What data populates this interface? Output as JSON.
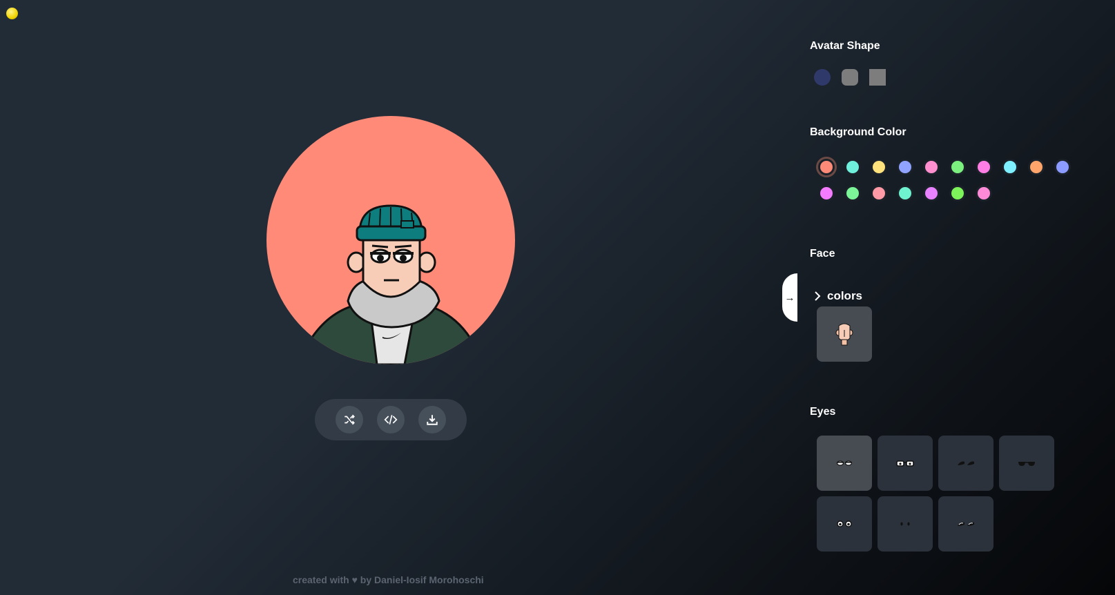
{
  "sections": {
    "avatar_shape": "Avatar Shape",
    "background_color": "Background Color",
    "face": "Face",
    "eyes": "Eyes"
  },
  "face_colors_label": "colors",
  "avatar_shapes": [
    {
      "name": "circle",
      "color": "#2f3a6b"
    },
    {
      "name": "rounded",
      "color": "#7d7d7d"
    },
    {
      "name": "square",
      "color": "#7d7d7d"
    }
  ],
  "background_colors": [
    "#ff8a78",
    "#6ff0dc",
    "#ffe27c",
    "#8fa3ff",
    "#ff8fcf",
    "#7cf07f",
    "#ff7ee6",
    "#7ff0ff",
    "#ffa56b",
    "#8c9bff",
    "#f27bff",
    "#7cf599",
    "#ff9aa6",
    "#6ff2cf",
    "#e882ff",
    "#7df45a",
    "#ff8bd8"
  ],
  "selected_background": "#ff8a78",
  "eyes_options": [
    "eyes-sleepy",
    "eyes-glasses",
    "eyes-wink",
    "eyes-sunglasses",
    "eyes-round",
    "eyes-dots",
    "eyes-narrow"
  ],
  "footer_text": "created with ♥ by Daniel-Iosif Morohoschi",
  "icons": {
    "toolbar": [
      "shuffle-icon",
      "code-icon",
      "download-icon"
    ],
    "panel_toggle": "arrow-right-icon",
    "colors_toggle": "chevron-right-icon"
  }
}
